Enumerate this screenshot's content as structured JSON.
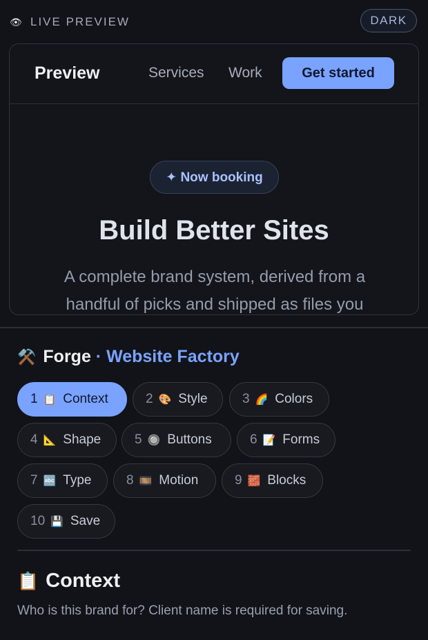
{
  "topbar": {
    "eye_icon": "👁",
    "label": "LIVE PREVIEW",
    "theme_button": "DARK"
  },
  "preview": {
    "brand": "Preview",
    "nav": [
      "Services",
      "Work"
    ],
    "cta": "Get started",
    "badge": "✦ Now booking",
    "hero_title": "Build Better Sites",
    "hero_subtitle": "A complete brand system, derived from a handful of picks and shipped as files you"
  },
  "forge": {
    "hammer_icon": "⚒️",
    "name": "Forge",
    "separator": " · ",
    "subtitle": "Website Factory"
  },
  "steps": [
    {
      "num": "1",
      "icon": "📋",
      "label": "Context",
      "active": true
    },
    {
      "num": "2",
      "icon": "🎨",
      "label": "Style"
    },
    {
      "num": "3",
      "icon": "🌈",
      "label": "Colors"
    },
    {
      "num": "4",
      "icon": "📐",
      "label": "Shape"
    },
    {
      "num": "5",
      "icon": "🔘",
      "label": "Buttons"
    },
    {
      "num": "6",
      "icon": "📝",
      "label": "Forms"
    },
    {
      "num": "7",
      "icon": "🔤",
      "label": "Type"
    },
    {
      "num": "8",
      "icon": "🎞️",
      "label": "Motion"
    },
    {
      "num": "9",
      "icon": "🧱",
      "label": "Blocks"
    },
    {
      "num": "10",
      "icon": "💾",
      "label": "Save"
    }
  ],
  "section": {
    "icon": "📋",
    "title": "Context",
    "description": "Who is this brand for? Client name is required for saving."
  },
  "colors": {
    "background": "#111318",
    "accent": "#7aa3ff"
  }
}
